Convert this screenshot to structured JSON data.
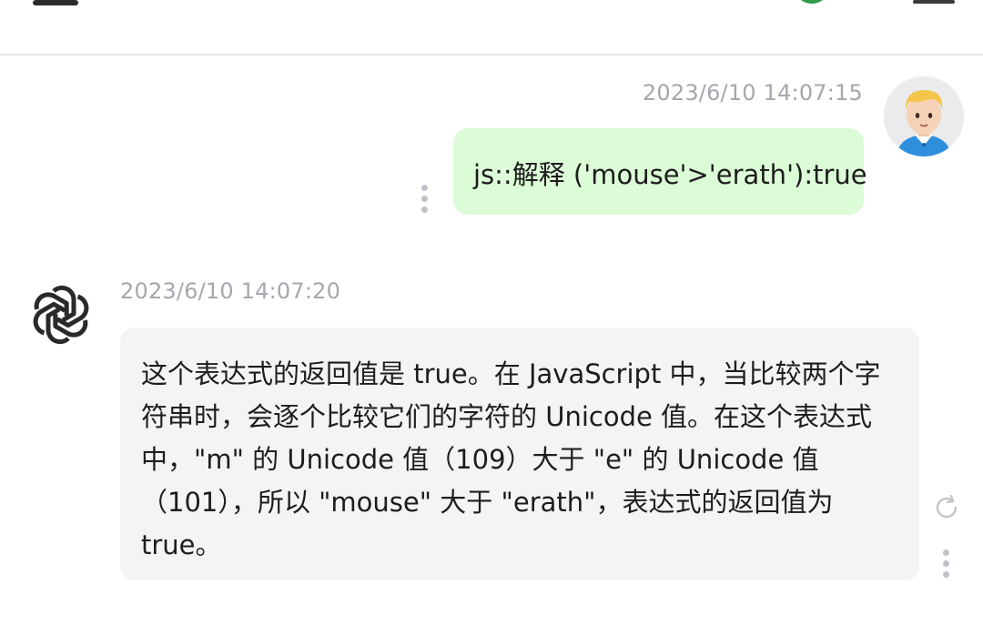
{
  "header": {
    "menu_icon": "hamburger-icon",
    "chat_icon": "whatsapp-icon",
    "more_icon": "more-icon"
  },
  "messages": [
    {
      "role": "user",
      "timestamp": "2023/6/10 14:07:15",
      "text": "js::解释 ('mouse'>'erath'):true",
      "avatar": "user-avatar-cartoon",
      "bubble_color": "#dcfbd7"
    },
    {
      "role": "assistant",
      "timestamp": "2023/6/10 14:07:20",
      "text": "这个表达式的返回值是 true。在 JavaScript 中，当比较两个字符串时，会逐个比较它们的字符的 Unicode 值。在这个表达式中，\"m\" 的 Unicode 值（109）大于 \"e\" 的 Unicode 值（101），所以 \"mouse\" 大于 \"erath\"，表达式的返回值为 true。",
      "avatar": "openai-logo",
      "bubble_color": "#f3f4f6"
    }
  ],
  "actions": {
    "user_more": "more-vertical-icon",
    "bot_refresh": "refresh-icon",
    "bot_more": "more-vertical-icon"
  }
}
